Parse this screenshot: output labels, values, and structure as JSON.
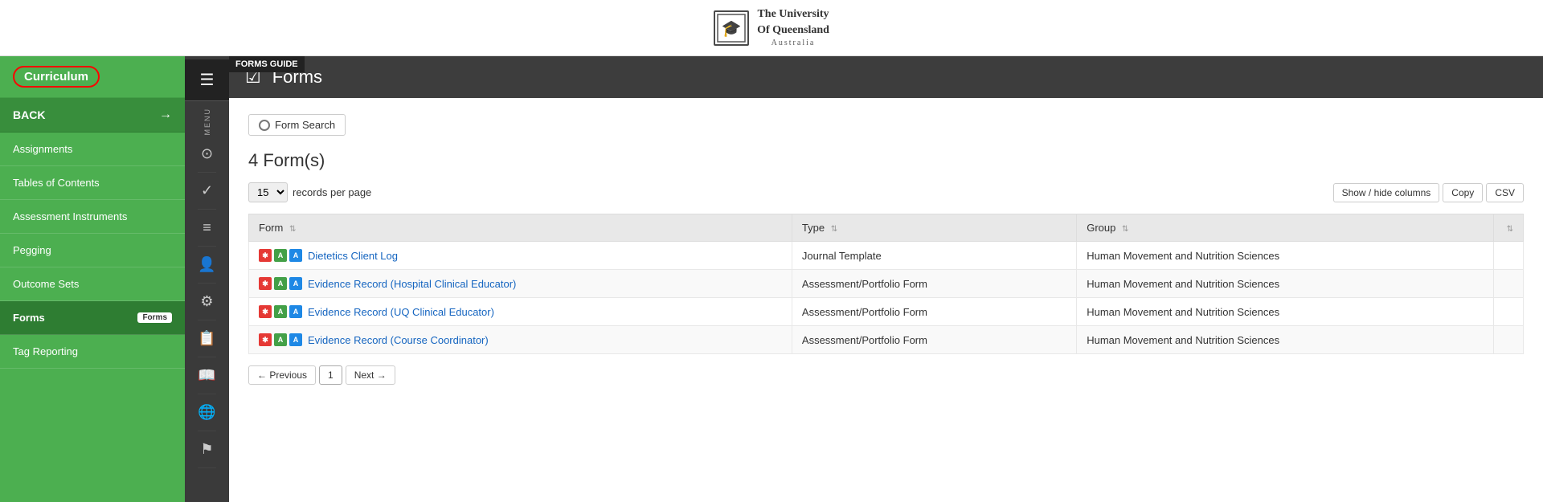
{
  "header": {
    "university_name": "The University\nOf Queensland",
    "university_sub": "Australia",
    "logo_symbol": "🎓"
  },
  "forms_guide_tooltip": "FORMS GUIDE",
  "sidebar": {
    "curriculum_label": "Curriculum",
    "back_label": "BACK",
    "nav_items": [
      {
        "id": "assignments",
        "label": "Assignments",
        "active": false
      },
      {
        "id": "tables-of-contents",
        "label": "Tables of Contents",
        "active": false
      },
      {
        "id": "assessment-instruments",
        "label": "Assessment Instruments",
        "active": false
      },
      {
        "id": "pegging",
        "label": "Pegging",
        "active": false
      },
      {
        "id": "outcome-sets",
        "label": "Outcome Sets",
        "active": false
      },
      {
        "id": "forms",
        "label": "Forms",
        "active": true,
        "badge": "Forms"
      },
      {
        "id": "tag-reporting",
        "label": "Tag Reporting",
        "active": false
      }
    ]
  },
  "icon_sidebar": {
    "menu_label": "MENU",
    "icons": [
      "⊙",
      "✓",
      "≡",
      "👤",
      "⚙",
      "📋",
      "📖",
      "🌐",
      "⚑"
    ]
  },
  "page_header": {
    "title": "Forms",
    "icon": "☑"
  },
  "content": {
    "form_search_label": "Form Search",
    "forms_count": "4 Form(s)",
    "records_per_page": "15",
    "records_label": "records per page",
    "show_hide_label": "Show / hide columns",
    "copy_label": "Copy",
    "csv_label": "CSV",
    "table": {
      "columns": [
        {
          "id": "form",
          "label": "Form"
        },
        {
          "id": "type",
          "label": "Type"
        },
        {
          "id": "group",
          "label": "Group"
        }
      ],
      "rows": [
        {
          "form_name": "Dietetics Client Log",
          "type": "Journal Template",
          "group": "Human Movement and Nutrition Sciences"
        },
        {
          "form_name": "Evidence Record (Hospital Clinical Educator)",
          "type": "Assessment/Portfolio Form",
          "group": "Human Movement and Nutrition Sciences"
        },
        {
          "form_name": "Evidence Record (UQ Clinical Educator)",
          "type": "Assessment/Portfolio Form",
          "group": "Human Movement and Nutrition Sciences"
        },
        {
          "form_name": "Evidence Record (Course Coordinator)",
          "type": "Assessment/Portfolio Form",
          "group": "Human Movement and Nutrition Sciences"
        }
      ]
    },
    "pagination": {
      "prev_label": "← Previous",
      "next_label": "Next →",
      "current_page": "1"
    }
  }
}
